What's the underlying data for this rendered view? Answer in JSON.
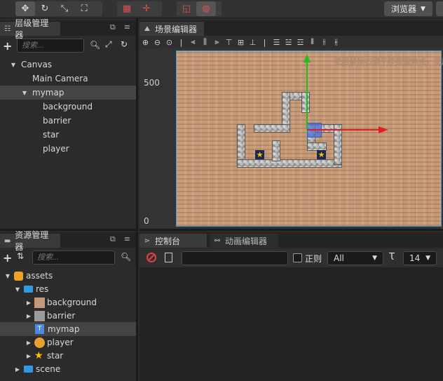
{
  "toolbar": {
    "browser_label": "浏览器"
  },
  "hierarchy": {
    "title": "层级管理器",
    "search_placeholder": "搜索...",
    "items": [
      {
        "label": "Canvas"
      },
      {
        "label": "Main Camera"
      },
      {
        "label": "mymap"
      },
      {
        "label": "background"
      },
      {
        "label": "barrier"
      },
      {
        "label": "star"
      },
      {
        "label": "player"
      }
    ]
  },
  "scene": {
    "title": "场景编辑器",
    "hint": "使用鼠标右键平移视窗焦点，使用滚轮缩放",
    "y_label_top": "500",
    "y_label_bottom": "0"
  },
  "assets": {
    "title": "资源管理器",
    "search_placeholder": "搜索...",
    "items": [
      {
        "label": "assets"
      },
      {
        "label": "res"
      },
      {
        "label": "background"
      },
      {
        "label": "barrier"
      },
      {
        "label": "mymap"
      },
      {
        "label": "player"
      },
      {
        "label": "star"
      },
      {
        "label": "scene"
      }
    ]
  },
  "console": {
    "tab_console": "控制台",
    "tab_animation": "动画编辑器",
    "regex_label": "正则",
    "level_value": "All",
    "font_size_value": "14"
  },
  "colors": {
    "accent_blue": "#3aa0d0",
    "gizmo_x": "#e02020",
    "gizmo_y": "#20c020",
    "folder_blue": "#2e9ae6"
  }
}
